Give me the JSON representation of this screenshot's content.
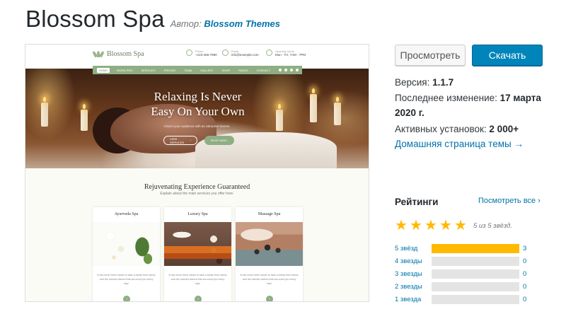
{
  "header": {
    "title": "Blossom Spa",
    "author_prefix": "Автор:",
    "author_name": "Blossom Themes"
  },
  "screenshot": {
    "logo_text": "Blossom Spa",
    "contacts": [
      {
        "label": "Phone",
        "value": "+123-456-7890"
      },
      {
        "label": "Email",
        "value": "info@example.com"
      },
      {
        "label": "Opening Hours",
        "value": "Mon - Fri, 7AM - 7PM"
      }
    ],
    "nav": [
      "Home",
      "Work-Pro",
      "Services",
      "Pricing",
      "Team",
      "Gallery",
      "Shop",
      "Pages",
      "Contact"
    ],
    "hero_title_line1": "Relaxing Is Never",
    "hero_title_line2": "Easy On Your Own",
    "hero_subtitle": "Charm your audience with an attractive banner.",
    "hero_btn1": "View Services",
    "hero_btn2": "Shop Now",
    "section_title": "Rejuvenating Experience Guaranteed",
    "section_subtitle": "Explain about the main services you offer here.",
    "cards": [
      {
        "title": "Ayurveda Spa",
        "text": "It has never been easier to take a break from stress and the harmful factors that surround you every day!"
      },
      {
        "title": "Luxury Spa",
        "text": "It has never been easier to take a break from stress and the harmful factors that surround you every day!"
      },
      {
        "title": "Massage Spa",
        "text": "It has never been easier to take a break from stress and the harmful factors that surround you every day!"
      }
    ]
  },
  "actions": {
    "preview": "Просмотреть",
    "download": "Скачать"
  },
  "meta": {
    "version_label": "Версия:",
    "version": "1.1.7",
    "updated_label": "Последнее изменение:",
    "updated_date": "17 марта",
    "updated_year": "2020 г.",
    "installs_label": "Активных установок:",
    "installs": "2 000+",
    "homepage_link": "Домашняя страница темы →"
  },
  "ratings": {
    "heading": "Рейтинги",
    "see_all": "Посмотреть все",
    "stars_value": 5,
    "summary": "5 из 5 звёзд.",
    "rows": [
      {
        "label": "5 звёзд",
        "count": "3",
        "fraction": 1.0
      },
      {
        "label": "4 звезды",
        "count": "0",
        "fraction": 0
      },
      {
        "label": "3 звезды",
        "count": "0",
        "fraction": 0
      },
      {
        "label": "2 звезды",
        "count": "0",
        "fraction": 0
      },
      {
        "label": "1 звезда",
        "count": "0",
        "fraction": 0
      }
    ]
  },
  "colors": {
    "accent": "#0073aa",
    "download": "#0085ba",
    "star": "#ffb900",
    "theme_green": "#8fae84"
  }
}
